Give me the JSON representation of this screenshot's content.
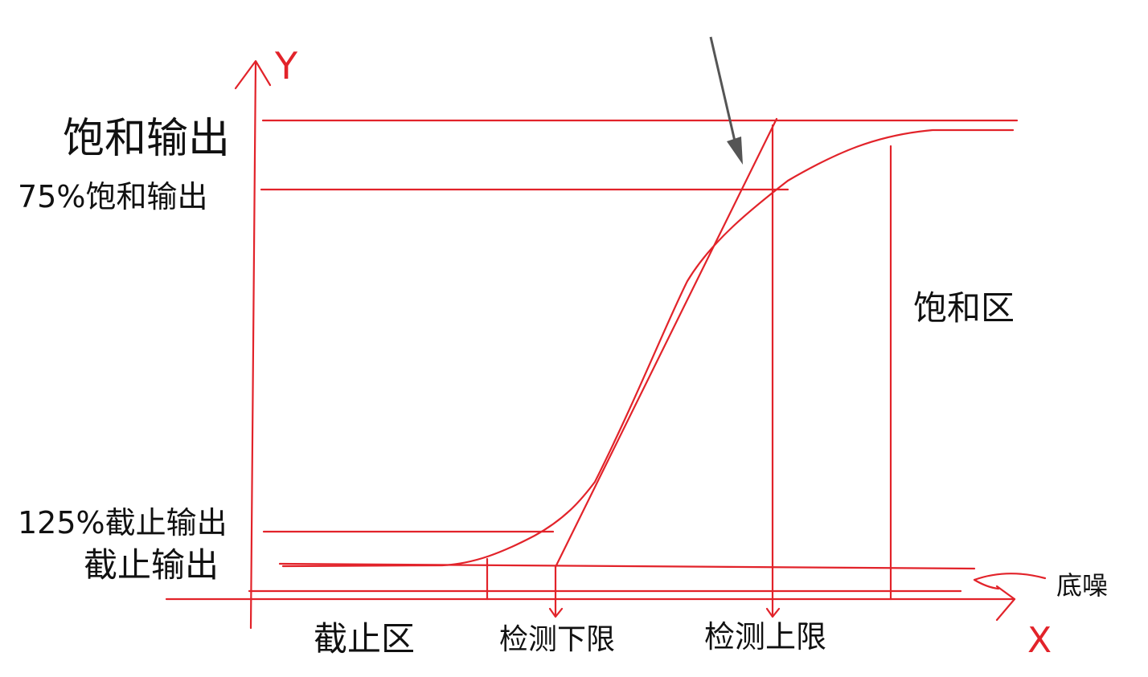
{
  "axes": {
    "y_label": "Y",
    "x_label": "X"
  },
  "y_labels": {
    "saturation_output": "饱和输出",
    "saturation_75": "75%饱和输出",
    "cutoff_125": "125%截止输出",
    "cutoff_output": "截止输出"
  },
  "regions": {
    "cutoff_region": "截止区",
    "saturation_region": "饱和区"
  },
  "limits": {
    "lower_detection_limit": "检测下限",
    "upper_detection_limit": "检测上限"
  },
  "annotations": {
    "noise_floor": "底噪"
  },
  "colors": {
    "line": "#e2232a",
    "arrow": "#555555",
    "text": "#111111"
  }
}
